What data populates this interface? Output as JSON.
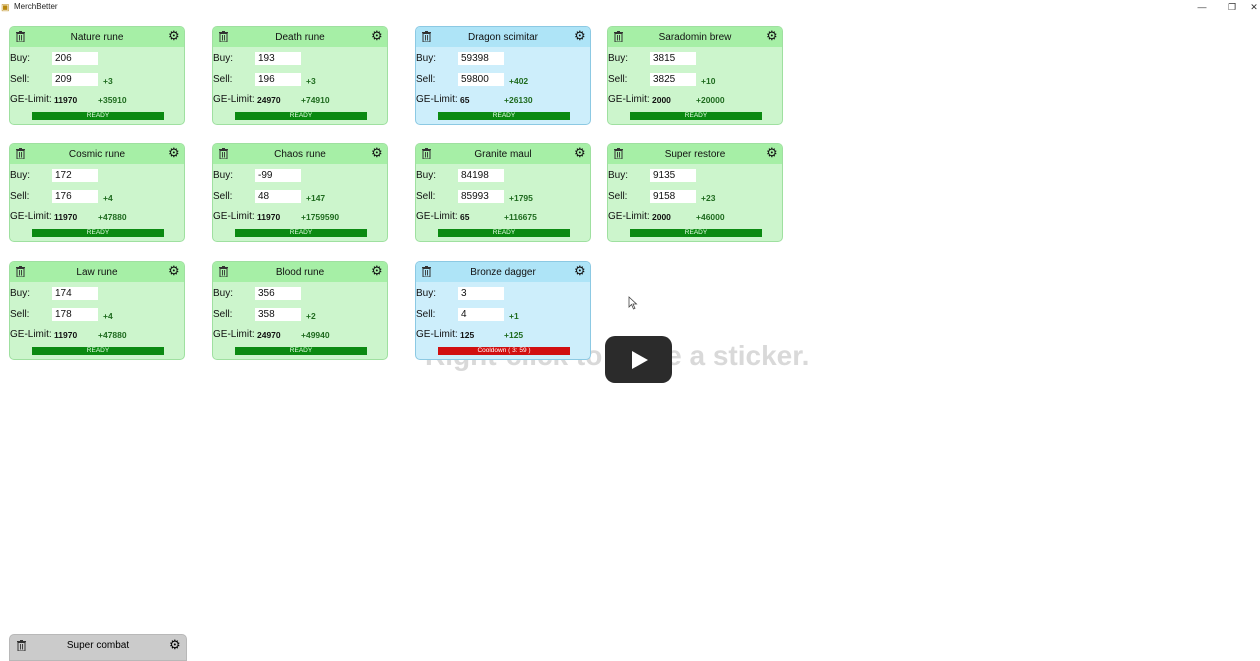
{
  "window": {
    "title": "MerchBetter",
    "minimize_glyph": "—",
    "restore_glyph": "❐",
    "close_glyph": "✕"
  },
  "hint_text": "Right-click to place a sticker.",
  "labels": {
    "buy": "Buy:",
    "sell": "Sell:",
    "limit": "GE-Limit:"
  },
  "colors": {
    "card_green": "#ccf5cc",
    "card_blue": "#cdeefb",
    "status_ready": "#0b8a12",
    "status_cooldown": "#d10f10"
  },
  "cards": [
    {
      "name": "Nature rune",
      "buy": "206",
      "sell": "209",
      "margin": "+3",
      "limit": "11970",
      "limit_profit": "+35910",
      "status": "READY",
      "theme": "green"
    },
    {
      "name": "Death rune",
      "buy": "193",
      "sell": "196",
      "margin": "+3",
      "limit": "24970",
      "limit_profit": "+74910",
      "status": "READY",
      "theme": "green"
    },
    {
      "name": "Dragon scimitar",
      "buy": "59398",
      "sell": "59800",
      "margin": "+402",
      "limit": "65",
      "limit_profit": "+26130",
      "status": "READY",
      "theme": "blue"
    },
    {
      "name": "Saradomin brew",
      "buy": "3815",
      "sell": "3825",
      "margin": "+10",
      "limit": "2000",
      "limit_profit": "+20000",
      "status": "READY",
      "theme": "green"
    },
    {
      "name": "Cosmic rune",
      "buy": "172",
      "sell": "176",
      "margin": "+4",
      "limit": "11970",
      "limit_profit": "+47880",
      "status": "READY",
      "theme": "green"
    },
    {
      "name": "Chaos rune",
      "buy": "-99",
      "sell": "48",
      "margin": "+147",
      "limit": "11970",
      "limit_profit": "+1759590",
      "status": "READY",
      "theme": "green"
    },
    {
      "name": "Granite maul",
      "buy": "84198",
      "sell": "85993",
      "margin": "+1795",
      "limit": "65",
      "limit_profit": "+116675",
      "status": "READY",
      "theme": "green"
    },
    {
      "name": "Super restore",
      "buy": "9135",
      "sell": "9158",
      "margin": "+23",
      "limit": "2000",
      "limit_profit": "+46000",
      "status": "READY",
      "theme": "green"
    },
    {
      "name": "Law rune",
      "buy": "174",
      "sell": "178",
      "margin": "+4",
      "limit": "11970",
      "limit_profit": "+47880",
      "status": "READY",
      "theme": "green"
    },
    {
      "name": "Blood rune",
      "buy": "356",
      "sell": "358",
      "margin": "+2",
      "limit": "24970",
      "limit_profit": "+49940",
      "status": "READY",
      "theme": "green"
    },
    {
      "name": "Bronze dagger",
      "buy": "3",
      "sell": "4",
      "margin": "+1",
      "limit": "125",
      "limit_profit": "+125",
      "status": "Cooldown ( 3: 59 )",
      "theme": "blue"
    }
  ],
  "partial_card": {
    "name": "Super combat"
  },
  "icons": {
    "trash": "trash-icon",
    "settings": "gear-icon",
    "play": "play-icon",
    "cursor": "mouse-cursor-icon"
  }
}
